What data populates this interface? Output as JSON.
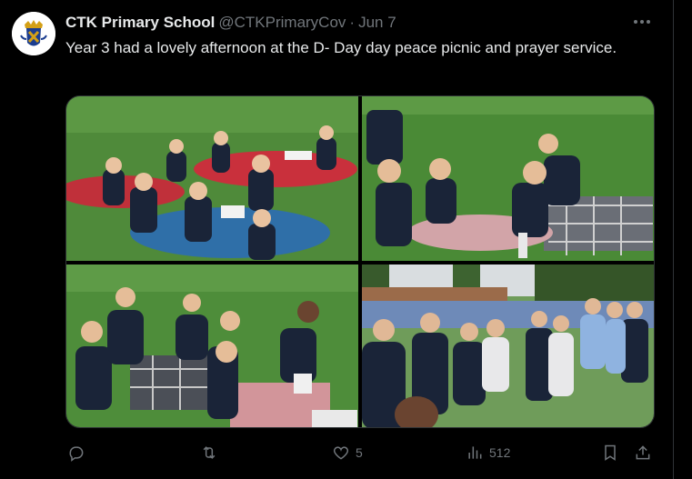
{
  "post": {
    "author_name": "CTK Primary School",
    "author_handle": "@CTKPrimaryCov",
    "separator": "·",
    "date": "Jun 7",
    "text": "Year 3 had a lovely afternoon at the D- Day day peace picnic and prayer service."
  },
  "media": [
    {
      "alt": "photo-1"
    },
    {
      "alt": "photo-2"
    },
    {
      "alt": "photo-3"
    },
    {
      "alt": "photo-4"
    }
  ],
  "actions": {
    "reply_count": "",
    "repost_count": "",
    "like_count": "5",
    "view_count": "512"
  },
  "icons": {
    "more": "more-horizontal-icon",
    "reply": "reply-icon",
    "repost": "repost-icon",
    "like": "heart-icon",
    "views": "views-icon",
    "bookmark": "bookmark-icon",
    "share": "share-icon"
  },
  "colors": {
    "background": "#000000",
    "text": "#e7e9ea",
    "muted": "#71767b",
    "border": "#2f3336"
  }
}
